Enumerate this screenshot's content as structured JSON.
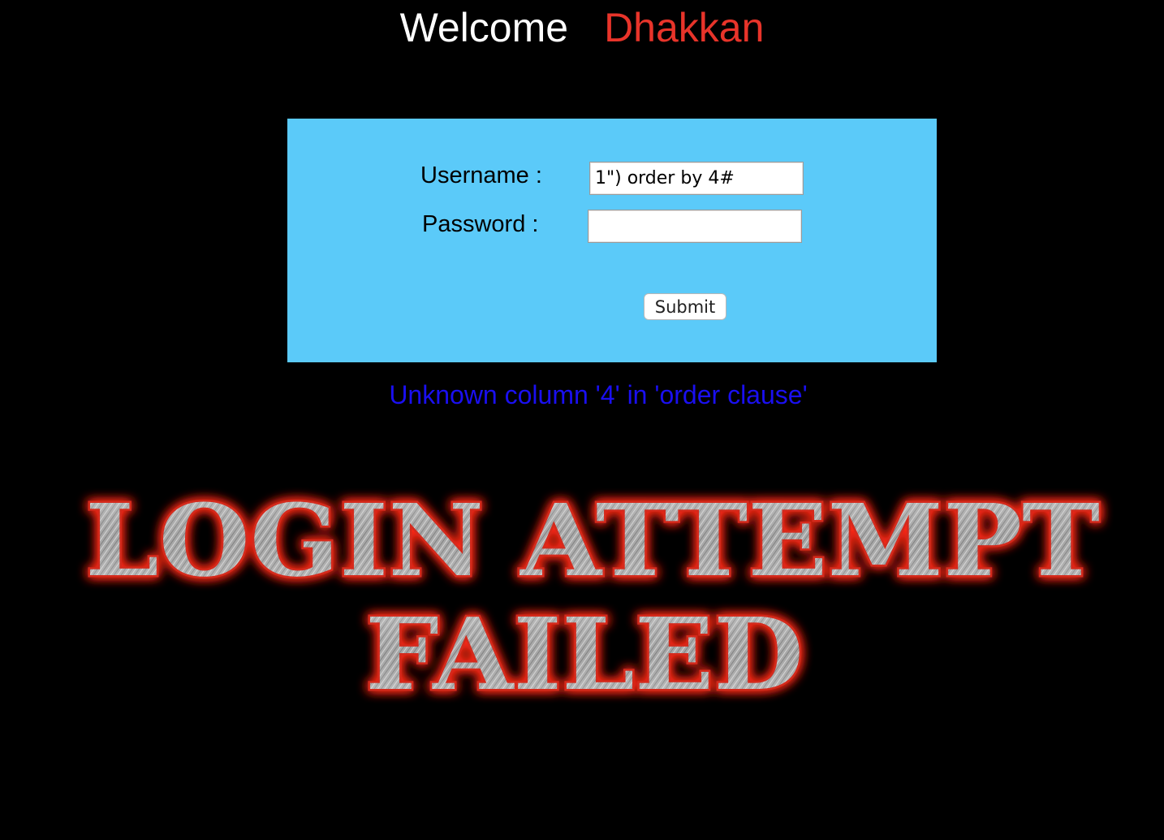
{
  "welcome": {
    "greeting": "Welcome",
    "name": "Dhakkan"
  },
  "login_form": {
    "username_label": "Username :",
    "password_label": "Password :",
    "username_value": "1\") order by 4#",
    "password_value": "",
    "submit_label": "Submit"
  },
  "error_message": "Unknown column '4' in 'order clause'",
  "banner": {
    "line1": "LOGIN ATTEMPT",
    "line2": "FAILED"
  },
  "colors": {
    "background": "#000000",
    "panel": "#5bcaf9",
    "name_accent": "#e8342a",
    "error_text": "#1a0ff0",
    "banner_glow": "#ff2a1a"
  }
}
